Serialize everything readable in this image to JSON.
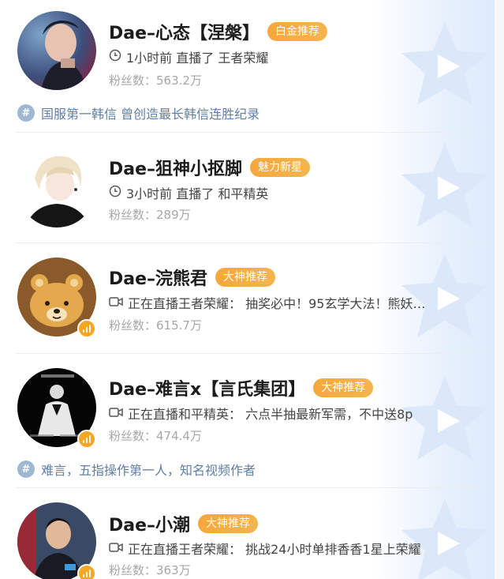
{
  "fans_label": "粉丝数：",
  "streamers": [
    {
      "name": "Dae–心态【涅槃】",
      "tag": "白金推荐",
      "status_type": "clock",
      "status": "1小时前 直播了 王者荣耀",
      "fans": "563.2万",
      "topic": "国服第一韩信 曾创造最长韩信连胜纪录",
      "is_live": false
    },
    {
      "name": "Dae–狙神小抠脚",
      "tag": "魅力新星",
      "status_type": "clock",
      "status": "3小时前 直播了 和平精英",
      "fans": "289万",
      "topic": "",
      "is_live": false
    },
    {
      "name": "Dae–浣熊君",
      "tag": "大神推荐",
      "status_type": "video",
      "status": "正在直播王者荣耀： 抽奖必中！95玄学大法！熊妖…",
      "fans": "615.7万",
      "topic": "",
      "is_live": true
    },
    {
      "name": "Dae–难言x【言氏集团】",
      "tag": "大神推荐",
      "status_type": "video",
      "status": "正在直播和平精英： 六点半抽最新军需，不中送8p",
      "fans": "474.4万",
      "topic": "难言，五指操作第一人，知名视频作者",
      "is_live": true
    },
    {
      "name": "Dae–小潮",
      "tag": "大神推荐",
      "status_type": "video",
      "status": "正在直播王者荣耀： 挑战24小时单排香香1星上荣耀",
      "fans": "363万",
      "topic": "",
      "is_live": true
    }
  ],
  "colors": {
    "tag_orange": "#f5a623",
    "topic_blue": "#5f7fa5",
    "fans_gray": "#a6a6a6"
  },
  "icons": [
    "clock-icon",
    "video-camera-icon",
    "hashtag-icon",
    "play-decoration-icon",
    "live-signal-icon"
  ]
}
